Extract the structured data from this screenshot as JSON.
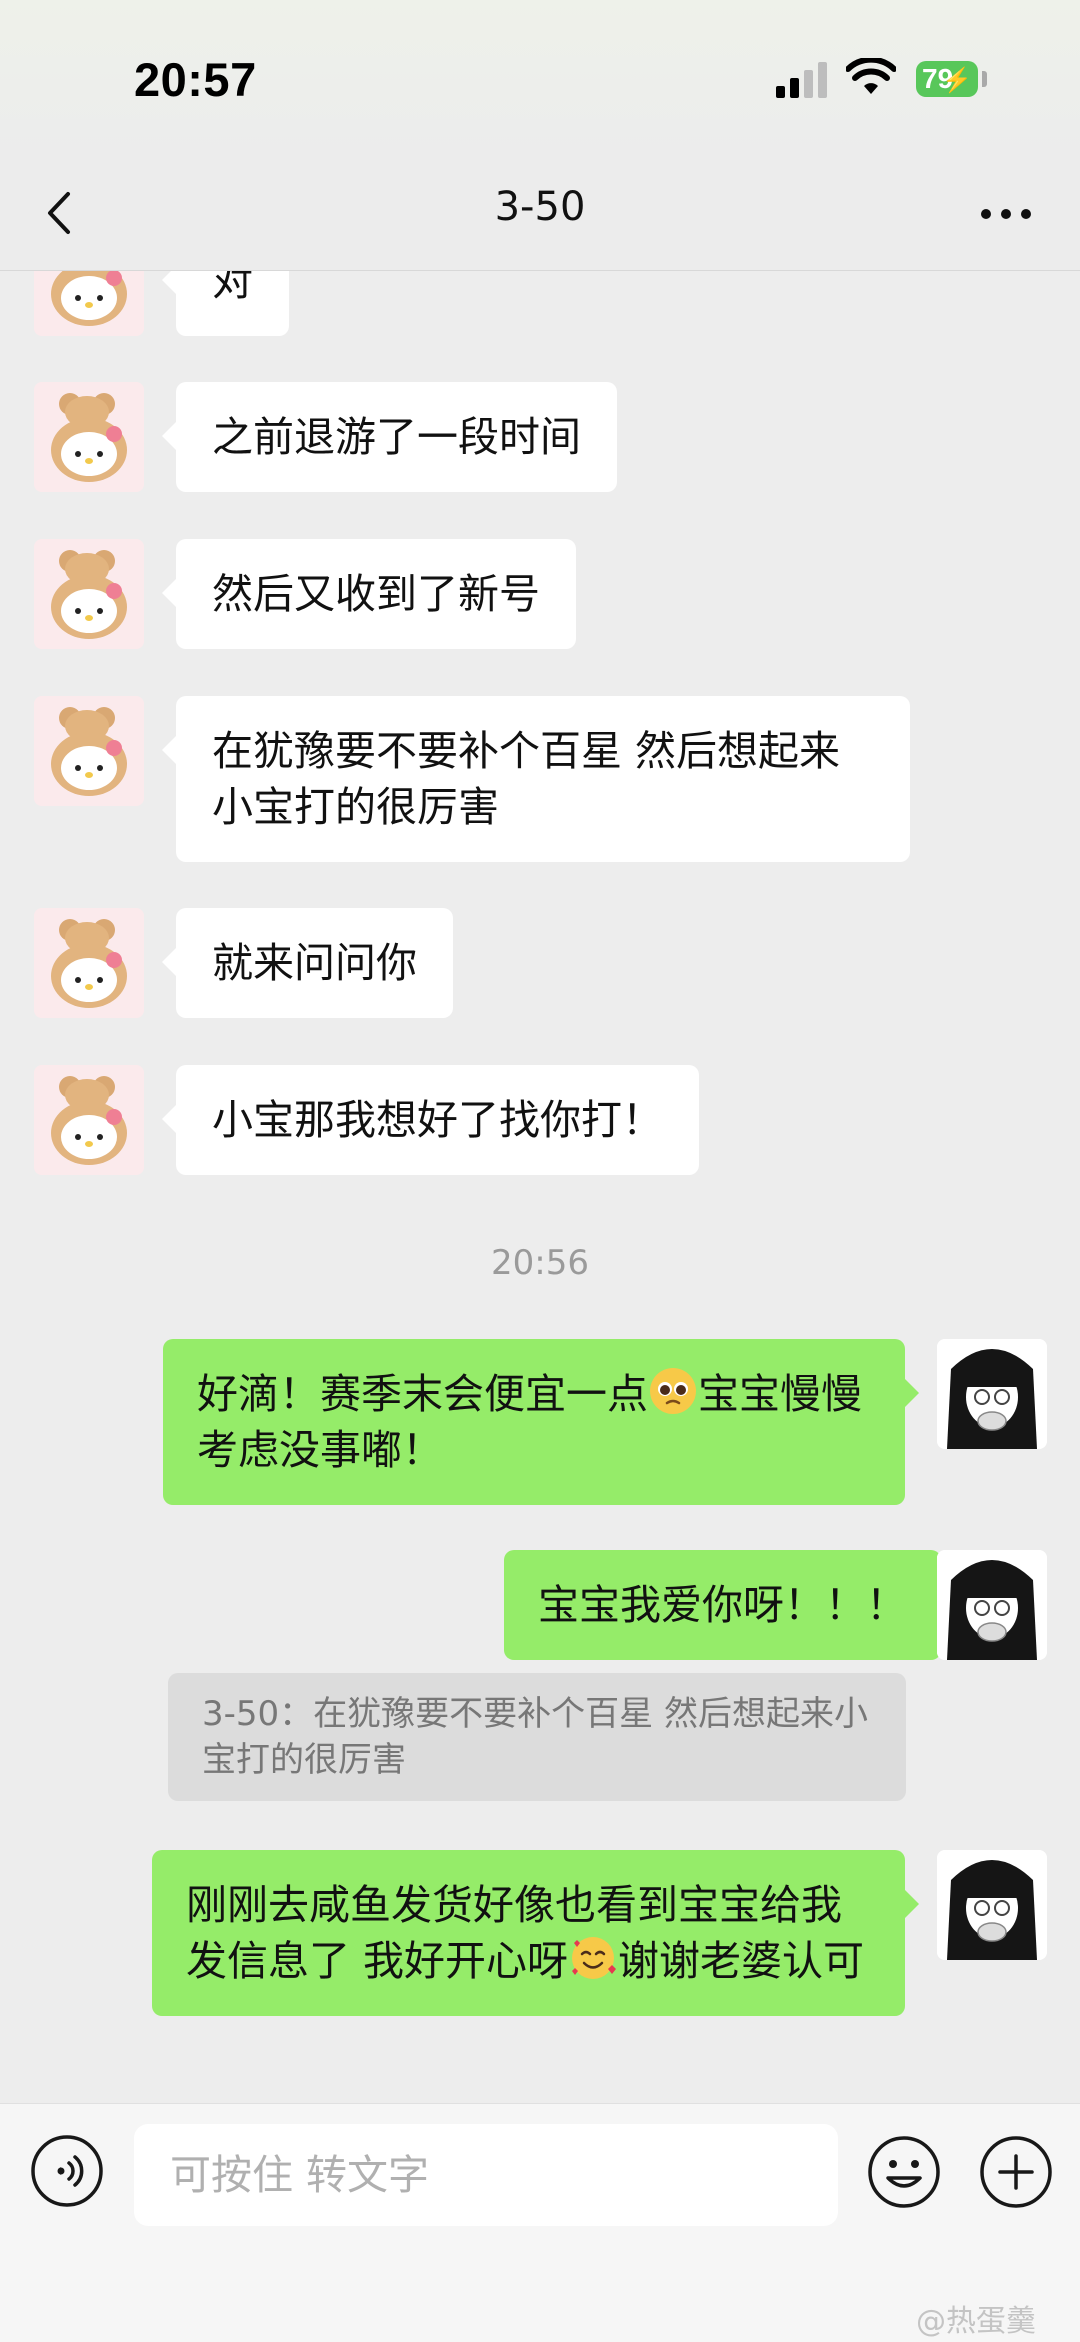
{
  "status_bar": {
    "time": "20:57",
    "battery": "79"
  },
  "nav": {
    "title": "3-50"
  },
  "messages": [
    {
      "from": "other",
      "text": "对"
    },
    {
      "from": "other",
      "text": "之前退游了一段时间"
    },
    {
      "from": "other",
      "text": "然后又收到了新号"
    },
    {
      "from": "other",
      "text": "在犹豫要不要补个百星 然后想起来小宝打的很厉害"
    },
    {
      "from": "other",
      "text": "就来问问你"
    },
    {
      "from": "other",
      "text": "小宝那我想好了找你打！"
    }
  ],
  "timestamp": "20:56",
  "my_messages": [
    {
      "from": "me",
      "text_before": "好滴！赛季末会便宜一点",
      "emoji": "pleading-face",
      "text_after": "宝宝慢慢考虑没事嘟！"
    },
    {
      "from": "me",
      "text": "宝宝我爱你呀！！！"
    },
    {
      "from": "me",
      "text_before": "刚刚去咸鱼发货好像也看到宝宝给我发信息了 我好开心呀",
      "emoji": "smiling-face-with-hearts",
      "text_after": "谢谢老婆认可"
    }
  ],
  "quote": {
    "text": "3-50：在犹豫要不要补个百星 然后想起来小宝打的很厉害"
  },
  "input": {
    "placeholder": "可按住 转文字"
  },
  "watermark": "@热蛋羹",
  "colors": {
    "background": "#ededed",
    "my_bubble": "#95ec69",
    "other_bubble": "#ffffff",
    "battery": "#58c75a"
  }
}
